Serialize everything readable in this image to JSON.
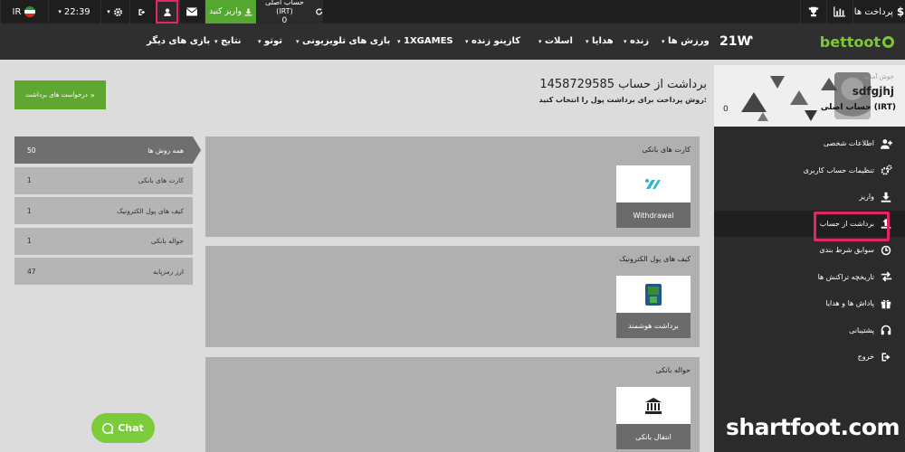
{
  "topbar": {
    "lang": "IR",
    "time": "22:39",
    "deposit_label": "واریز کنید",
    "balance_label": "حساب اصلی (IRT)",
    "balance_value": "0",
    "payments_label": "پرداخت ها"
  },
  "nav": {
    "logo": "bettoot",
    "brand_1x": "21Ⱳ",
    "items": [
      {
        "label": "ورزش ها",
        "dropdown": true
      },
      {
        "label": "زنده",
        "dropdown": true
      },
      {
        "label": "هدایا",
        "dropdown": true
      },
      {
        "label": "اسلات",
        "dropdown": true
      },
      {
        "label": "کازینو زنده",
        "dropdown": true
      },
      {
        "label": "1XGAMES",
        "dropdown": true
      },
      {
        "label": "بازی های تلویزیونی",
        "dropdown": true
      },
      {
        "label": "توتو",
        "dropdown": true
      },
      {
        "label": "نتایج",
        "dropdown": true
      },
      {
        "label": "بازی های دیگر",
        "dropdown": false
      }
    ]
  },
  "profile": {
    "small": "خوش آمدید",
    "name": "sdfgjhj",
    "account": "حساب اصلی (IRT)",
    "balance": "0"
  },
  "sidebar": {
    "items": [
      {
        "label": "اطلاعات شخصی",
        "icon": "user-plus-icon"
      },
      {
        "label": "تنظیمات حساب کاربری",
        "icon": "gears-icon"
      },
      {
        "label": "واریز",
        "icon": "download-icon"
      },
      {
        "label": "برداشت از حساب",
        "icon": "upload-icon",
        "active": true
      },
      {
        "label": "سوابق شرط بندی",
        "icon": "history-icon"
      },
      {
        "label": "تاریخچه تراکنش ها",
        "icon": "transfer-icon"
      },
      {
        "label": "پاداش ها و هدایا",
        "icon": "gift-icon"
      },
      {
        "label": "پشتیبانی",
        "icon": "headset-icon"
      },
      {
        "label": "خروج",
        "icon": "logout-icon"
      }
    ]
  },
  "main": {
    "title": "برداشت از حساب 1458729585",
    "subtitle": "روش پرداخت برای برداشت پول را انتخاب کنید:",
    "requests_button": "درخواست های برداشت",
    "categories": [
      {
        "label": "همه روش ها",
        "count": "50"
      },
      {
        "label": "کارت های بانکی",
        "count": "1"
      },
      {
        "label": "کیف های پول الکترونیک",
        "count": "1"
      },
      {
        "label": "حواله بانکی",
        "count": "1"
      },
      {
        "label": "ارز رمزپایه",
        "count": "47"
      }
    ],
    "panels": [
      {
        "title": "کارت های بانکی",
        "method_label": "Withdrawal"
      },
      {
        "title": "کیف های پول الکترونیک",
        "method_label": "برداشت هوشمند"
      },
      {
        "title": "حواله بانکی",
        "method_label": "انتقال بانکی"
      }
    ]
  },
  "chat_label": "Chat",
  "watermark": "shartfoot.com",
  "colors": {
    "accent_green": "#5ea832",
    "highlight_pink": "#e4256b",
    "dark_bg": "#2b2b2b"
  }
}
